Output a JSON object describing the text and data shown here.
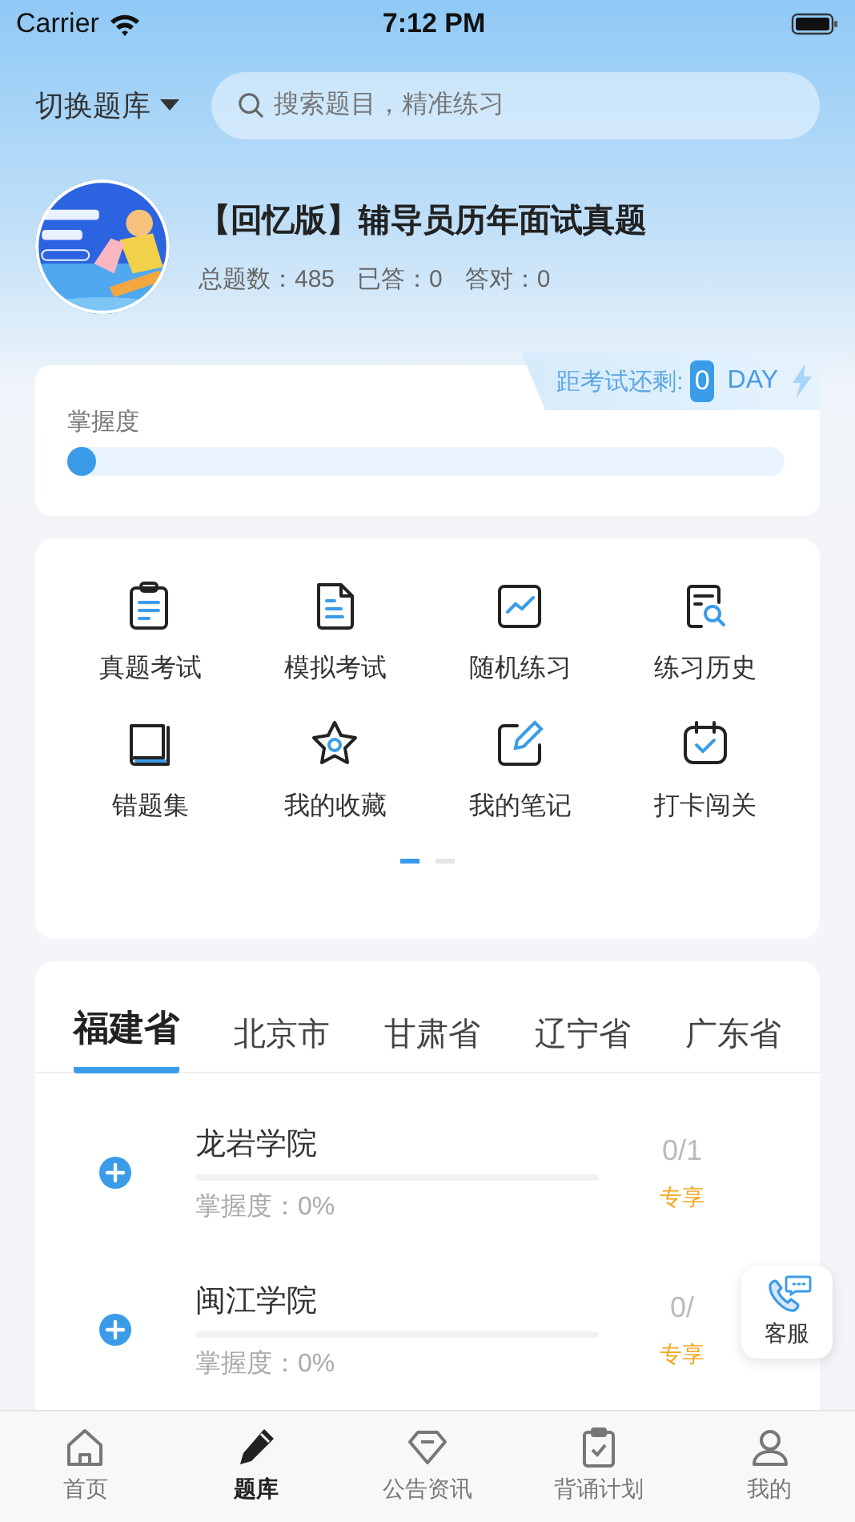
{
  "status_bar": {
    "carrier": "Carrier",
    "time": "7:12 PM"
  },
  "header": {
    "switch_label": "切换题库",
    "search": {
      "placeholder": "搜索题目，精准练习"
    }
  },
  "book": {
    "title": "【回忆版】辅导员历年面试真题",
    "stats": [
      "总题数：485",
      "已答：0",
      "答对：0"
    ]
  },
  "mastery": {
    "label": "掌握度",
    "level": 0,
    "countdown": {
      "label": "距考试还剩:",
      "days": "0",
      "unit": "DAY"
    }
  },
  "features": [
    {
      "label": "真题考试"
    },
    {
      "label": "模拟考试"
    },
    {
      "label": "随机练习"
    },
    {
      "label": "练习历史"
    },
    {
      "label": "错题集"
    },
    {
      "label": "我的收藏"
    },
    {
      "label": "我的笔记"
    },
    {
      "label": "打卡闯关"
    }
  ],
  "feature_pages": [
    {
      "selected": true
    },
    {
      "selected": false
    }
  ],
  "region_tabs": [
    {
      "label": "福建省",
      "selected": true
    },
    {
      "label": "北京市",
      "selected": false
    },
    {
      "label": "甘肃省",
      "selected": false
    },
    {
      "label": "辽宁省",
      "selected": false
    },
    {
      "label": "广东省",
      "selected": false
    }
  ],
  "schools": [
    {
      "name": "龙岩学院",
      "level": 0,
      "mastery": "掌握度：0%",
      "count": "0/1",
      "badge": "专享"
    },
    {
      "name": "闽江学院",
      "level": 0,
      "mastery": "掌握度：0%",
      "count": "0/",
      "badge": "专享"
    }
  ],
  "support_button": {
    "label": "客服"
  },
  "tab_bar": [
    {
      "label": "首页",
      "selected": false
    },
    {
      "label": "题库",
      "selected": true
    },
    {
      "label": "公告资讯",
      "selected": false
    },
    {
      "label": "背诵计划",
      "selected": false
    },
    {
      "label": "我的",
      "selected": false
    }
  ]
}
